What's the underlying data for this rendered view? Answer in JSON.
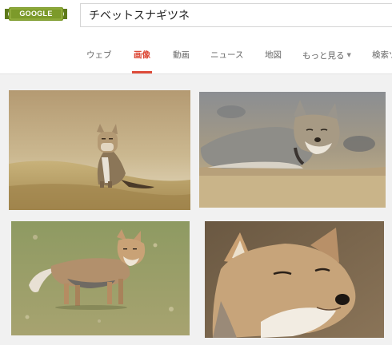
{
  "logo": {
    "text": "GOOGLE",
    "color": "#7c9a2a"
  },
  "search": {
    "query": "チベットスナギツネ"
  },
  "tabs": [
    {
      "label": "ウェブ",
      "active": false
    },
    {
      "label": "画像",
      "active": true
    },
    {
      "label": "動画",
      "active": false
    },
    {
      "label": "ニュース",
      "active": false
    },
    {
      "label": "地図",
      "active": false
    },
    {
      "label": "もっと見る",
      "active": false
    },
    {
      "label": "検索ツ",
      "active": false
    }
  ],
  "accent_color": "#dd4b39",
  "results": [
    {
      "subject": "tibetan-fox-sitting-on-hillside"
    },
    {
      "subject": "tibetan-fox-lying-on-grass"
    },
    {
      "subject": "tibetan-fox-standing-on-meadow"
    },
    {
      "subject": "tibetan-fox-face-closeup"
    }
  ]
}
